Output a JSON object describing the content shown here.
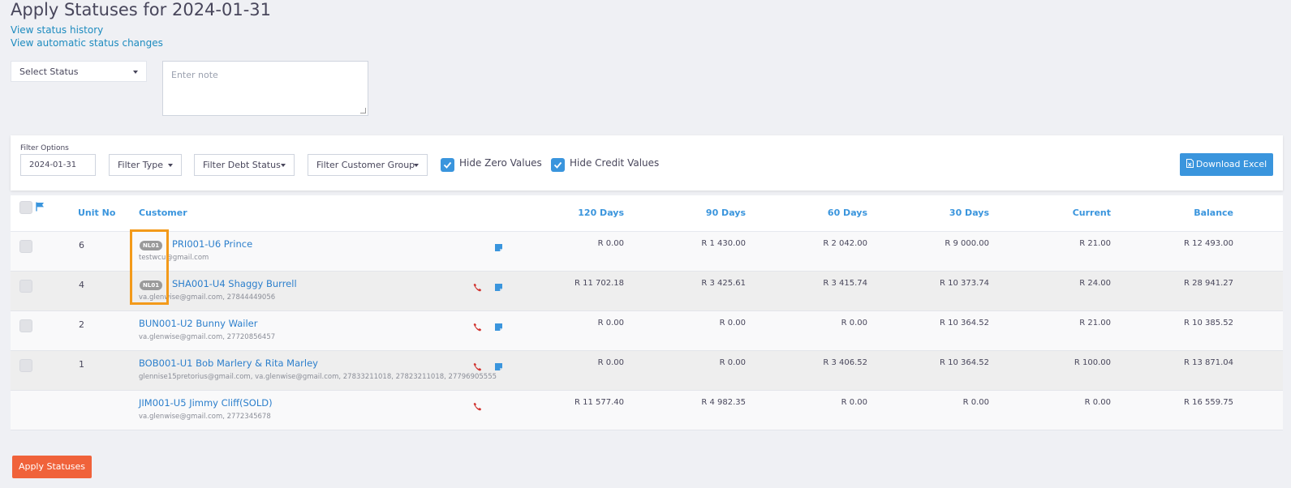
{
  "page": {
    "title": "Apply Statuses for 2024-01-31",
    "links": [
      "View status history",
      "View automatic status changes"
    ],
    "select_status": "Select Status",
    "note_placeholder": "Enter note"
  },
  "filters": {
    "label": "Filter Options",
    "date": "2024-01-31",
    "filter_type": "Filter Type",
    "filter_debt_status": "Filter Debt Status",
    "filter_customer_group": "Filter Customer Group",
    "hide_zero": "Hide Zero Values",
    "hide_credit": "Hide Credit Values",
    "download": "Download Excel"
  },
  "table": {
    "headers": [
      "Unit No",
      "Customer",
      "120 Days",
      "90 Days",
      "60 Days",
      "30 Days",
      "Current",
      "Balance"
    ],
    "rows": [
      {
        "unit": "6",
        "badge": "NL01",
        "customer": "PRI001-U6 Prince",
        "contact": "testwcu@gmail.com",
        "phone": false,
        "note": true,
        "d120": "R 0.00",
        "d90": "R 1 430.00",
        "d60": "R 2 042.00",
        "d30": "R 9 000.00",
        "current": "R 21.00",
        "balance": "R 12 493.00"
      },
      {
        "unit": "4",
        "badge": "NL01",
        "customer": "SHA001-U4 Shaggy Burrell",
        "contact": "va.glenwise@gmail.com, 27844449056",
        "phone": true,
        "note": true,
        "d120": "R 11 702.18",
        "d90": "R 3 425.61",
        "d60": "R 3 415.74",
        "d30": "R 10 373.74",
        "current": "R 24.00",
        "balance": "R 28 941.27"
      },
      {
        "unit": "2",
        "badge": "",
        "customer": "BUN001-U2 Bunny Wailer",
        "contact": "va.glenwise@gmail.com, 27720856457",
        "phone": true,
        "note": true,
        "d120": "R 0.00",
        "d90": "R 0.00",
        "d60": "R 0.00",
        "d30": "R 10 364.52",
        "current": "R 21.00",
        "balance": "R 10 385.52"
      },
      {
        "unit": "1",
        "badge": "",
        "customer": "BOB001-U1 Bob Marlery & Rita Marley",
        "contact": "glennise15pretorius@gmail.com, va.glenwise@gmail.com, 27833211018, 27823211018, 27796905555",
        "phone": true,
        "note": true,
        "d120": "R 0.00",
        "d90": "R 0.00",
        "d60": "R 3 406.52",
        "d30": "R 10 364.52",
        "current": "R 100.00",
        "balance": "R 13 871.04"
      },
      {
        "unit": "",
        "badge": "",
        "customer": "JIM001-U5 Jimmy Cliff(SOLD)",
        "contact": "va.glenwise@gmail.com, 2772345678",
        "phone": true,
        "note": false,
        "d120": "R 11 577.40",
        "d90": "R 4 982.35",
        "d60": "R 0.00",
        "d30": "R 0.00",
        "current": "R 0.00",
        "balance": "R 16 559.75"
      }
    ]
  },
  "apply_button": "Apply Statuses",
  "colors": {
    "accent": "#3a95dd",
    "apply": "#f0623a",
    "highlight": "#f39a1a",
    "phone": "#d0312d"
  }
}
